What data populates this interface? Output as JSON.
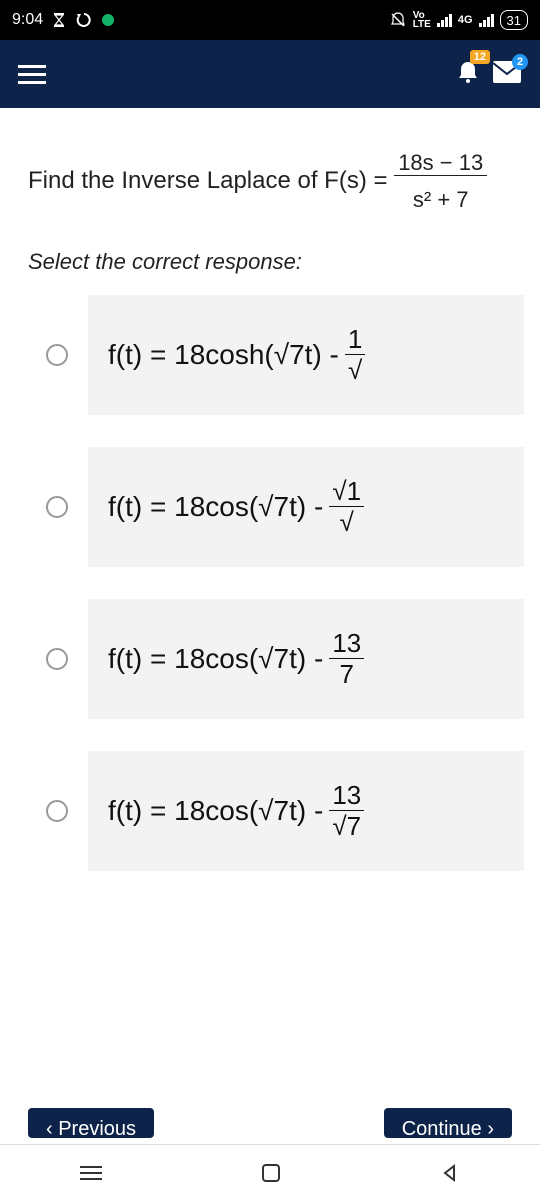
{
  "status": {
    "time": "9:04",
    "network_label": "4G",
    "battery": "31",
    "vo": "Vo",
    "lte": "LTE"
  },
  "header": {
    "notif_badge": "12",
    "mail_badge": "2"
  },
  "question": {
    "prefix": "Find the Inverse Laplace of F(s) = ",
    "frac_num": "18s − 13",
    "frac_den": "s² + 7"
  },
  "instruction": "Select the correct response:",
  "options": [
    {
      "main": "f(t) = 18cosh(√7t) - ",
      "frac_num": "1",
      "frac_den": "√"
    },
    {
      "main": "f(t) = 18cos(√7t) - ",
      "frac_num": "√1",
      "frac_den": "√"
    },
    {
      "main": "f(t) = 18cos(√7t) - ",
      "frac_num": "13",
      "frac_den": "7"
    },
    {
      "main": "f(t) = 18cos(√7t) - ",
      "frac_num": "13",
      "frac_den": "√7"
    }
  ],
  "buttons": {
    "prev": "‹  Previous",
    "next": "Continue  ›"
  }
}
